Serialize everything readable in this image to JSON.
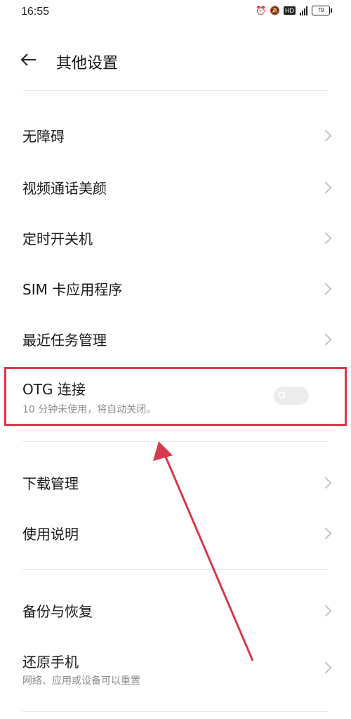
{
  "status_bar": {
    "time": "16:55",
    "icons": [
      "alarm-icon",
      "bell-off-icon",
      "hd-icon",
      "signal-icon",
      "battery-icon"
    ],
    "hd_label": "HD",
    "battery_level": "79"
  },
  "header": {
    "title": "其他设置",
    "back_icon": "back-arrow-icon"
  },
  "items": [
    {
      "label": "无障碍"
    },
    {
      "label": "视频通话美颜"
    },
    {
      "label": "定时开关机"
    },
    {
      "label": "SIM 卡应用程序"
    },
    {
      "label": "最近任务管理"
    }
  ],
  "otg": {
    "label": "OTG 连接",
    "subtitle": "10 分钟未使用，将自动关闭。",
    "enabled": false
  },
  "items2": [
    {
      "label": "下载管理"
    },
    {
      "label": "使用说明"
    }
  ],
  "items3": [
    {
      "label": "备份与恢复"
    },
    {
      "label": "还原手机",
      "subtitle": "网络、应用或设备可以重置"
    }
  ],
  "colors": {
    "highlight": "#d73a4a",
    "arrow": "#d73a4a"
  }
}
